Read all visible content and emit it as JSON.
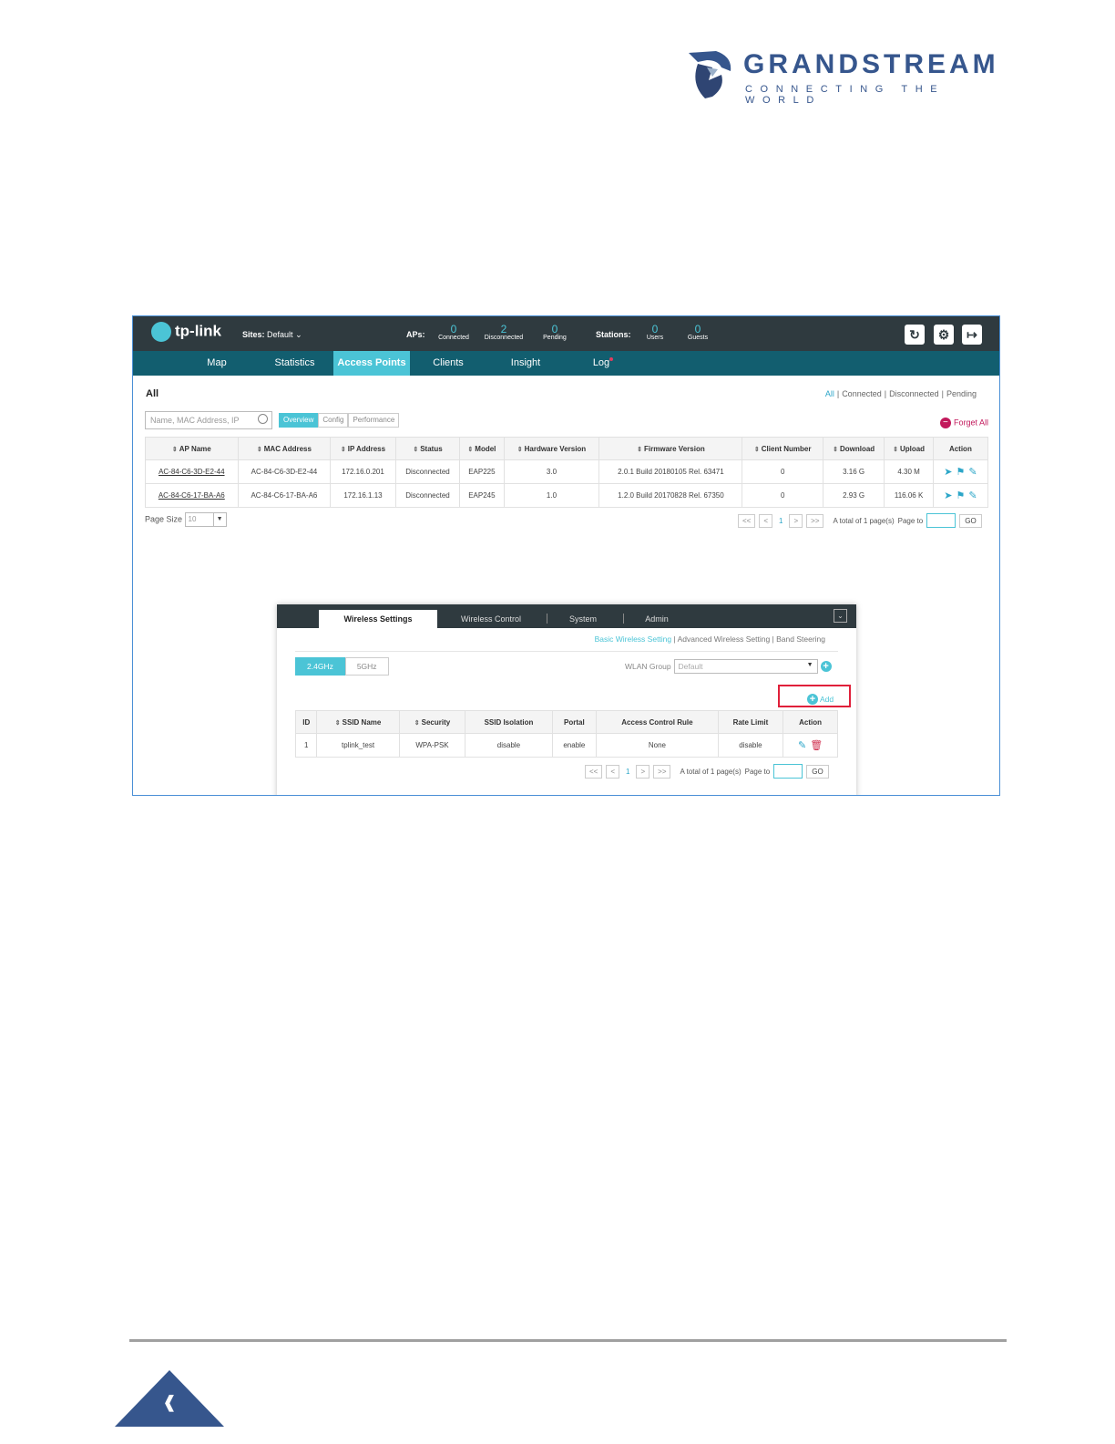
{
  "brand": {
    "name": "GRANDSTREAM",
    "tagline": "CONNECTING THE WORLD"
  },
  "topbar": {
    "logo": "tp-link",
    "sites_label": "Sites:",
    "sites_value": "Default",
    "aps_label": "APs:",
    "aps": [
      {
        "num": "0",
        "label": "Connected"
      },
      {
        "num": "2",
        "label": "Disconnected"
      },
      {
        "num": "0",
        "label": "Pending"
      }
    ],
    "stations_label": "Stations:",
    "stations": [
      {
        "num": "0",
        "label": "Users"
      },
      {
        "num": "0",
        "label": "Guests"
      }
    ]
  },
  "nav": {
    "items": [
      "Map",
      "Statistics",
      "Access Points",
      "Clients",
      "Insight",
      "Log"
    ],
    "active": "Access Points"
  },
  "ap_page": {
    "title": "All",
    "filters": [
      "All",
      "Connected",
      "Disconnected",
      "Pending"
    ],
    "search_placeholder": "Name, MAC Address, IP",
    "views": [
      "Overview",
      "Config",
      "Performance"
    ],
    "forget_all": "Forget All",
    "columns": [
      "AP Name",
      "MAC Address",
      "IP Address",
      "Status",
      "Model",
      "Hardware Version",
      "Firmware Version",
      "Client Number",
      "Download",
      "Upload",
      "Action"
    ],
    "rows": [
      [
        "AC-84-C6-3D-E2-44",
        "AC-84-C6-3D-E2-44",
        "172.16.0.201",
        "Disconnected",
        "EAP225",
        "3.0",
        "2.0.1 Build 20180105 Rel. 63471",
        "0",
        "3.16 G",
        "4.30 M"
      ],
      [
        "AC-84-C6-17-BA-A6",
        "AC-84-C6-17-BA-A6",
        "172.16.1.13",
        "Disconnected",
        "EAP245",
        "1.0",
        "1.2.0 Build 20170828 Rel. 67350",
        "0",
        "2.93 G",
        "116.06 K"
      ]
    ],
    "page_size_label": "Page Size",
    "page_size_value": "10",
    "pager": {
      "first": "<<",
      "prev": "<",
      "current": "1",
      "next": ">",
      "last": ">>",
      "total": "A total of 1 page(s)",
      "page_to": "Page to",
      "go": "GO"
    }
  },
  "dialog": {
    "tabs": [
      "Wireless Settings",
      "Wireless Control",
      "System",
      "Admin"
    ],
    "subnav": [
      "Basic Wireless Setting",
      "Advanced Wireless Setting",
      "Band Steering"
    ],
    "bands": [
      "2.4GHz",
      "5GHz"
    ],
    "wlan_group_label": "WLAN Group",
    "wlan_group_value": "Default",
    "add_label": "Add",
    "columns": [
      "ID",
      "SSID Name",
      "Security",
      "SSID Isolation",
      "Portal",
      "Access Control Rule",
      "Rate Limit",
      "Action"
    ],
    "rows": [
      [
        "1",
        "tplink_test",
        "WPA-PSK",
        "disable",
        "enable",
        "None",
        "disable"
      ]
    ],
    "pager": {
      "first": "<<",
      "prev": "<",
      "current": "1",
      "next": ">",
      "last": ">>",
      "total": "A total of 1 page(s)",
      "page_to": "Page to",
      "go": "GO"
    }
  },
  "colors": {
    "accent": "#4bc4d6",
    "nav": "#125e6f",
    "topbar": "#2f3a3f",
    "highlight": "#e0203a",
    "brand": "#36568d"
  }
}
